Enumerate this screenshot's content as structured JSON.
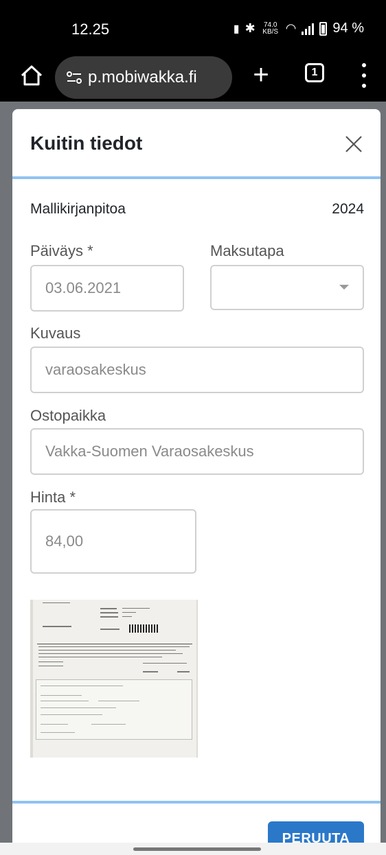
{
  "status_bar": {
    "time": "12.25",
    "net_speed": "74.0 KB/S",
    "battery": "94 %"
  },
  "browser": {
    "url": "p.mobiwakka.fi",
    "tab_count": "1"
  },
  "modal": {
    "title": "Kuitin tiedot",
    "company": "Mallikirjanpitoa",
    "year": "2024",
    "date_label": "Päiväys *",
    "date_value": "03.06.2021",
    "payment_label": "Maksutapa",
    "payment_value": "",
    "desc_label": "Kuvaus",
    "desc_value": "varaosakeskus",
    "place_label": "Ostopaikka",
    "place_value": "Vakka-Suomen Varaosakeskus",
    "price_label": "Hinta *",
    "price_value": "84,00",
    "cancel_label": "PERUUTA"
  },
  "colors": {
    "accent": "#2b78c9",
    "divider": "#90c2f2",
    "backdrop": "#707478"
  }
}
